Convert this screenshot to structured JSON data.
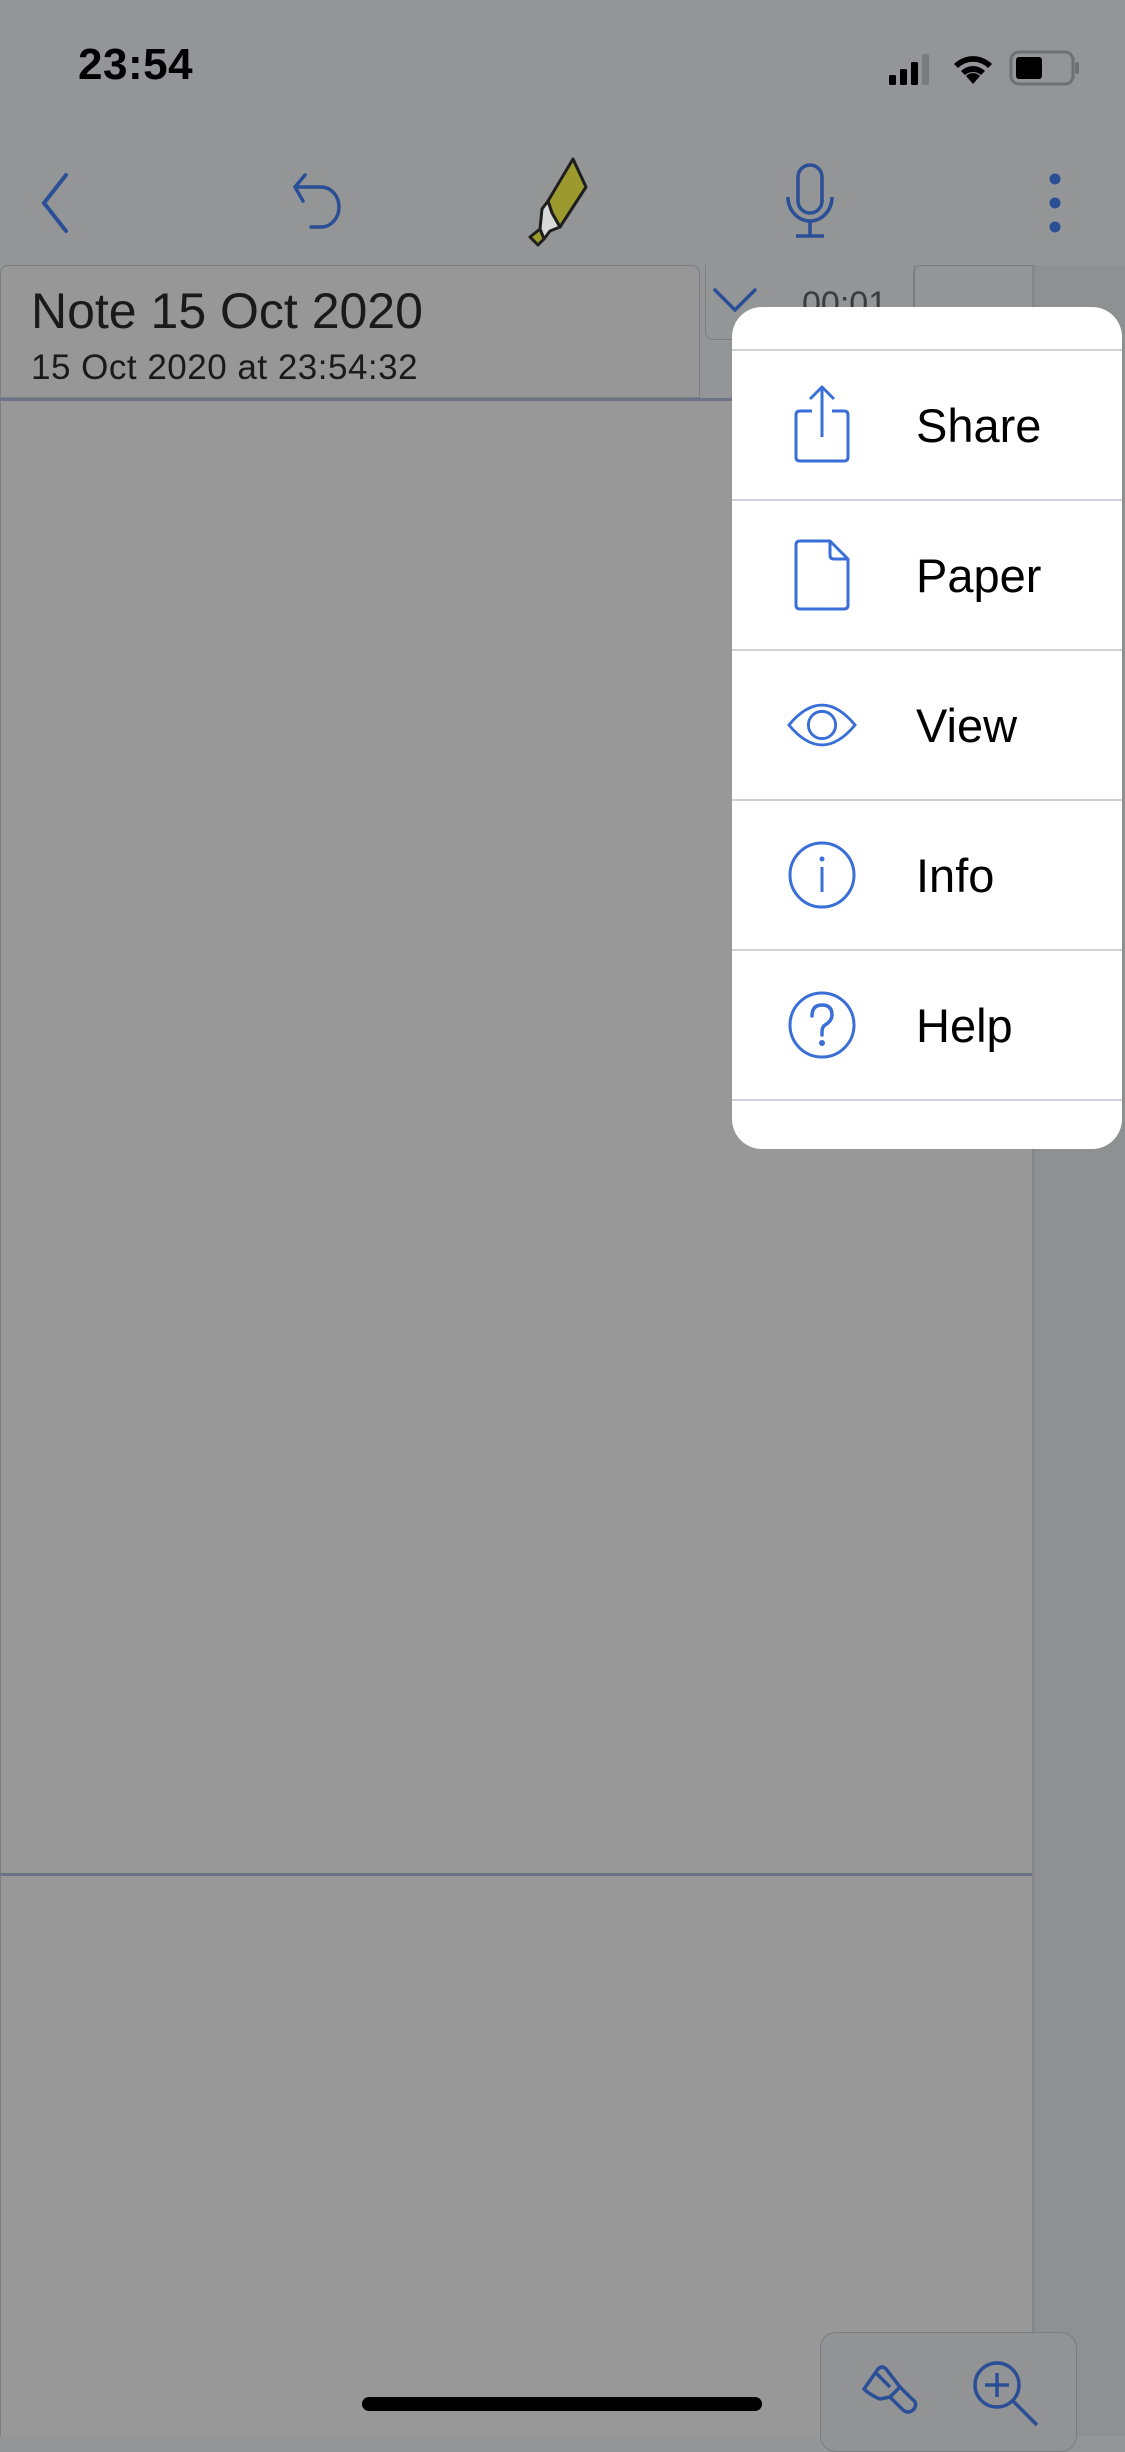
{
  "status_bar": {
    "time": "23:54",
    "icons": [
      "cellular-signal-icon",
      "wifi-icon",
      "battery-icon"
    ]
  },
  "toolbar": {
    "buttons": [
      {
        "name": "back-button",
        "icon": "chevron-left-icon"
      },
      {
        "name": "undo-button",
        "icon": "undo-arrow-icon"
      },
      {
        "name": "highlighter-button",
        "icon": "highlighter-icon"
      },
      {
        "name": "microphone-button",
        "icon": "microphone-icon"
      },
      {
        "name": "more-button",
        "icon": "more-vertical-icon"
      }
    ]
  },
  "note": {
    "title": "Note 15 Oct 2020",
    "subtitle": "15 Oct 2020 at 23:54:32",
    "recording_time": "00:01"
  },
  "menu": {
    "items": [
      {
        "label": "Share",
        "icon": "share-icon"
      },
      {
        "label": "Paper",
        "icon": "document-icon"
      },
      {
        "label": "View",
        "icon": "eye-icon"
      },
      {
        "label": "Info",
        "icon": "info-circle-icon"
      },
      {
        "label": "Help",
        "icon": "help-circle-icon"
      }
    ]
  },
  "bottom_tools": {
    "buttons": [
      {
        "name": "brush-button",
        "icon": "paintbrush-icon"
      },
      {
        "name": "zoom-in-button",
        "icon": "zoom-in-icon"
      }
    ]
  },
  "colors": {
    "accent": "#3a6fd8",
    "dimmed_accent": "#2b4f96",
    "highlighter": "#9c9a2e",
    "overlay_bg": "#949597",
    "menu_bg": "#ffffff"
  }
}
